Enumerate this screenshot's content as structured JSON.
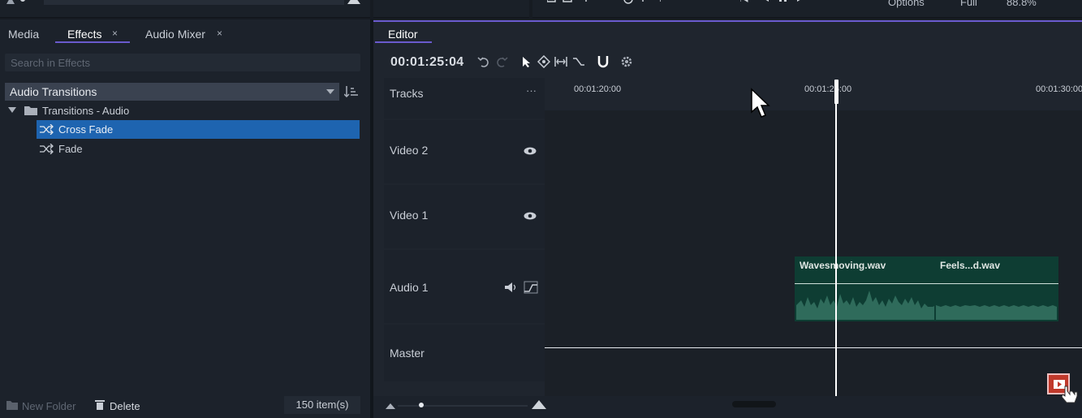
{
  "left_panel": {
    "tabs": [
      {
        "label": "Media"
      },
      {
        "label": "Effects",
        "close": "×"
      },
      {
        "label": "Audio Mixer",
        "close": "×"
      }
    ],
    "search_placeholder": "Search in Effects",
    "category": "Audio Transitions",
    "tree": {
      "folder": "Transitions - Audio",
      "items": [
        "Cross Fade",
        "Fade"
      ],
      "selected": "Cross Fade"
    },
    "footer": {
      "new_folder": "New Folder",
      "delete": "Delete",
      "count": "150 item(s)"
    }
  },
  "top_strip": {
    "options": "Options",
    "full": "Full",
    "zoom": "88.8%"
  },
  "editor": {
    "tab": "Editor",
    "timecode": "00:01:25:04",
    "tracks_header": "Tracks",
    "more": "···",
    "ruler": [
      "00:01:20:00",
      "00:01:25:00",
      "00:01:30:00"
    ],
    "tracks": [
      "Video 2",
      "Video 1",
      "Audio 1",
      "Master"
    ],
    "clips": [
      {
        "name": "Wavesmoving.wav"
      },
      {
        "name": "Feels...d.wav"
      }
    ]
  },
  "colors": {
    "accent": "#6a5acd",
    "selection": "#1e64b0",
    "clip": "#0e3d33",
    "waveform": "#2f6b5b"
  }
}
